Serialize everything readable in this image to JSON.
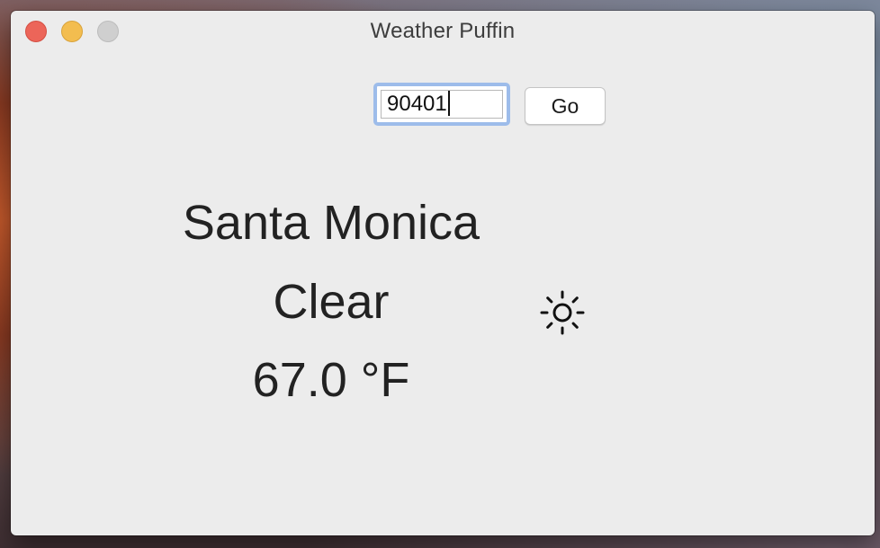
{
  "window": {
    "title": "Weather Puffin"
  },
  "search": {
    "zip_value": "90401",
    "go_label": "Go"
  },
  "weather": {
    "city": "Santa Monica",
    "condition": "Clear",
    "temperature": "67.0 °F",
    "icon": "sun-icon"
  },
  "colors": {
    "close": "#ec6559",
    "minimize": "#f3bd4f",
    "zoom_inactive": "#cfcfcf",
    "focus_ring": "#9dbcea",
    "window_bg": "#ececec"
  }
}
